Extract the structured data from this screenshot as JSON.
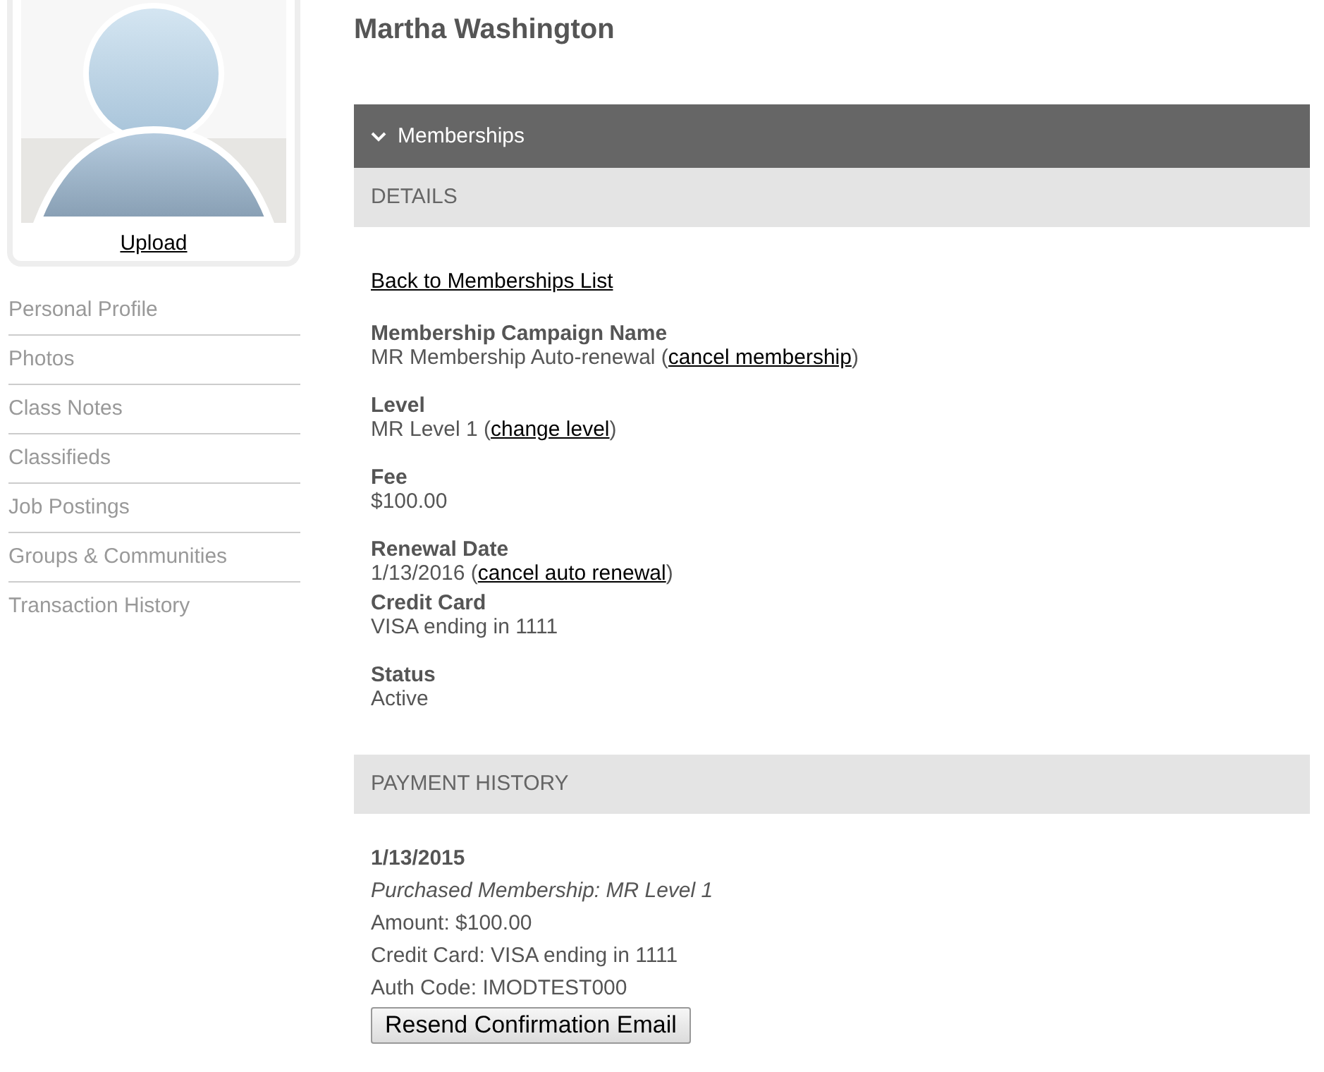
{
  "profile": {
    "upload_link": "Upload"
  },
  "sidebar": {
    "items": [
      {
        "label": "Personal Profile"
      },
      {
        "label": "Photos"
      },
      {
        "label": "Class Notes"
      },
      {
        "label": "Classifieds"
      },
      {
        "label": "Job Postings"
      },
      {
        "label": "Groups & Communities"
      },
      {
        "label": "Transaction History"
      }
    ]
  },
  "member_name": "Martha Washington",
  "section": {
    "title": "Memberships",
    "expanded": true
  },
  "details": {
    "heading": "DETAILS",
    "back_link": "Back to Memberships List",
    "fields": [
      {
        "label": "Membership Campaign Name",
        "value": "MR Membership Auto-renewal (",
        "link": "cancel membership",
        "after": ")"
      },
      {
        "label": "Level",
        "value": "MR Level 1 (",
        "link": "change level",
        "after": ")"
      },
      {
        "label": "Fee",
        "value": "$100.00"
      },
      {
        "label": "Renewal Date",
        "value": "1/13/2016 (",
        "link": "cancel auto renewal",
        "after": ")"
      },
      {
        "label": "Credit Card",
        "value": "VISA ending in 1111"
      },
      {
        "label": "Status",
        "value": "Active"
      }
    ]
  },
  "payment_history": {
    "heading": "PAYMENT HISTORY",
    "entries": [
      {
        "date": "1/13/2015",
        "description": "Purchased Membership: MR Level 1",
        "amount": "Amount: $100.00",
        "card": "Credit Card: VISA ending in 1111",
        "auth": "Auth Code: IMODTEST000",
        "button": "Resend Confirmation Email"
      }
    ]
  }
}
